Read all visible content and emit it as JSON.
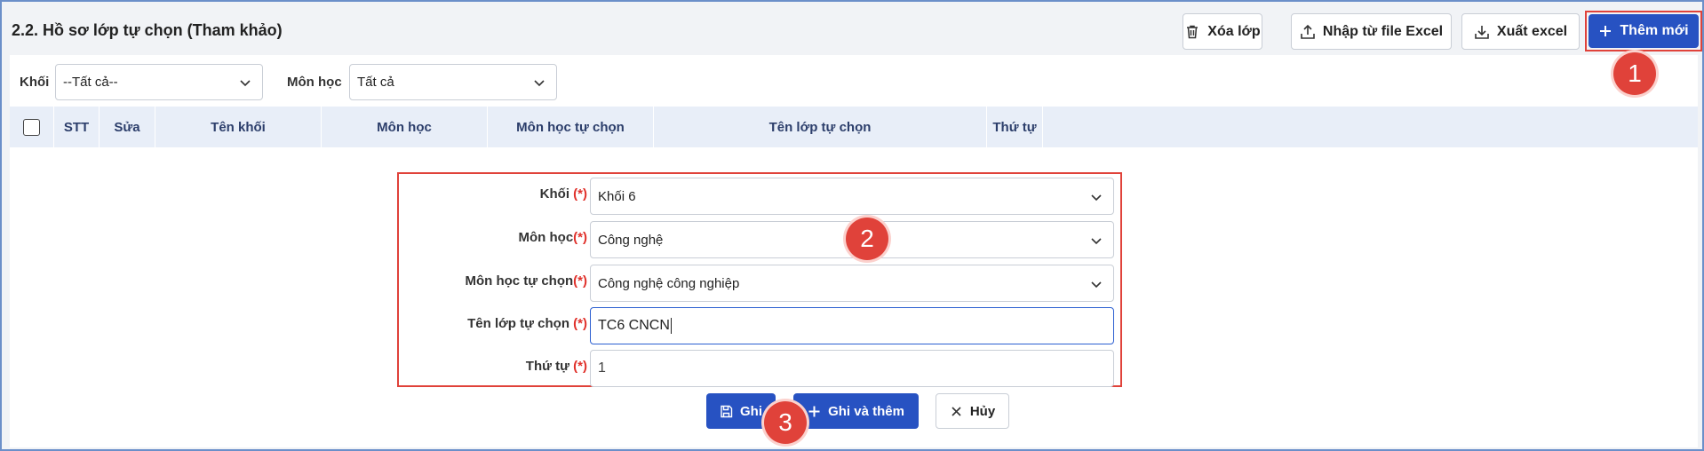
{
  "header": {
    "title": "2.2. Hồ sơ lớp tự chọn (Tham khảo)",
    "buttons": {
      "delete": "Xóa lớp",
      "import": "Nhập từ file Excel",
      "export": "Xuất excel",
      "add_new": "Thêm mới"
    }
  },
  "filters": {
    "khoi_label": "Khối",
    "khoi_value": "--Tất cả--",
    "monhoc_label": "Môn học",
    "monhoc_value": "Tất cả"
  },
  "grid": {
    "columns": [
      "STT",
      "Sửa",
      "Tên khối",
      "Môn học",
      "Môn học tự chọn",
      "Tên lớp tự chọn",
      "Thứ tự"
    ]
  },
  "form": {
    "required_mark": "(*)",
    "rows": [
      {
        "label": "Khối ",
        "value": "Khối 6",
        "type": "select"
      },
      {
        "label": "Môn học",
        "value": "Công nghệ",
        "type": "select"
      },
      {
        "label": "Môn học tự chọn",
        "value": "Công nghệ công nghiệp",
        "type": "select"
      },
      {
        "label": "Tên lớp tự chọn ",
        "value": "TC6 CNCN",
        "type": "text"
      },
      {
        "label": "Thứ tự ",
        "value": "1",
        "type": "text"
      }
    ]
  },
  "actions": {
    "save": "Ghi",
    "save_and_add": "Ghi và thêm",
    "cancel": "Hủy"
  },
  "annotations": {
    "step1": "1",
    "step2": "2",
    "step3": "3"
  },
  "colors": {
    "primary": "#2752c2",
    "highlight": "#e0423a",
    "grid_header_bg": "#e8eef8"
  }
}
